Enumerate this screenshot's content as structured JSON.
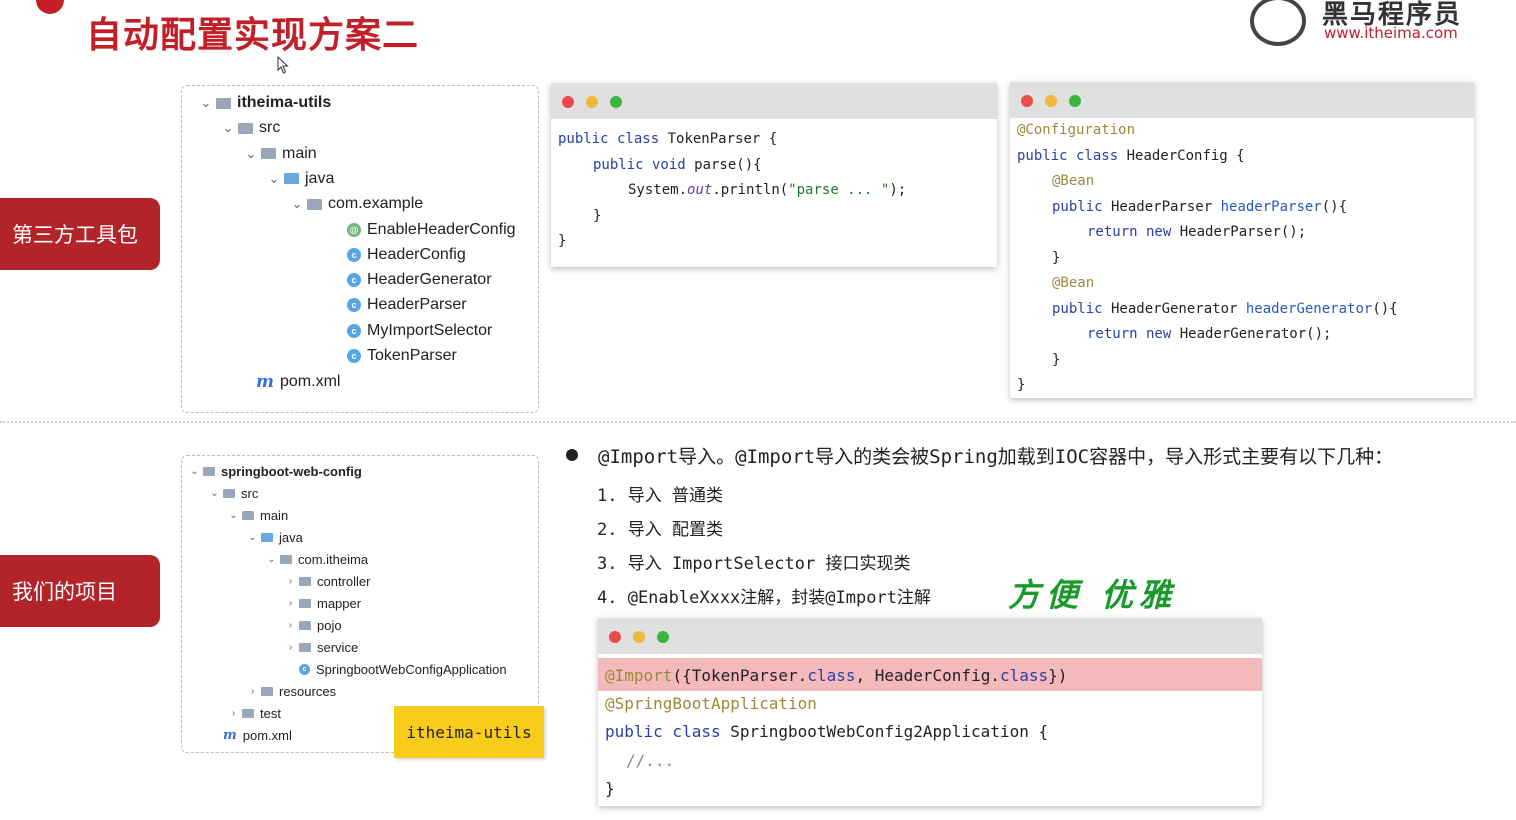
{
  "slide": {
    "title": "自动配置实现方案二",
    "logo_cn": "黑马程序员",
    "logo_url": "www.itheima.com",
    "section_labels": [
      "第三方工具包",
      "我们的项目"
    ]
  },
  "tree1": {
    "items": [
      {
        "label": "itheima-utils",
        "icon": "module-folder-icon",
        "chevron": "v"
      },
      {
        "label": "src",
        "icon": "folder-icon",
        "chevron": "v"
      },
      {
        "label": "main",
        "icon": "folder-icon",
        "chevron": "v"
      },
      {
        "label": "java",
        "icon": "source-folder-icon",
        "chevron": "v"
      },
      {
        "label": "com.example",
        "icon": "package-icon",
        "chevron": "v"
      },
      {
        "label": "EnableHeaderConfig",
        "icon": "annotation-icon",
        "chevron": ""
      },
      {
        "label": "HeaderConfig",
        "icon": "class-icon",
        "chevron": ""
      },
      {
        "label": "HeaderGenerator",
        "icon": "class-icon",
        "chevron": ""
      },
      {
        "label": "HeaderParser",
        "icon": "class-icon",
        "chevron": ""
      },
      {
        "label": "MyImportSelector",
        "icon": "class-icon",
        "chevron": ""
      },
      {
        "label": "TokenParser",
        "icon": "class-icon",
        "chevron": ""
      },
      {
        "label": "pom.xml",
        "icon": "maven-icon",
        "chevron": ""
      }
    ]
  },
  "tree2": {
    "items": [
      {
        "label": "springboot-web-config",
        "icon": "module-folder-icon",
        "chevron": "v"
      },
      {
        "label": "src",
        "icon": "folder-icon",
        "chevron": "v"
      },
      {
        "label": "main",
        "icon": "folder-icon",
        "chevron": "v"
      },
      {
        "label": "java",
        "icon": "source-folder-icon",
        "chevron": "v"
      },
      {
        "label": "com.itheima",
        "icon": "package-icon",
        "chevron": "v"
      },
      {
        "label": "controller",
        "icon": "package-icon",
        "chevron": ">"
      },
      {
        "label": "mapper",
        "icon": "package-icon",
        "chevron": ">"
      },
      {
        "label": "pojo",
        "icon": "package-icon",
        "chevron": ">"
      },
      {
        "label": "service",
        "icon": "package-icon",
        "chevron": ">"
      },
      {
        "label": "SpringbootWebConfigApplication",
        "icon": "spring-class-icon",
        "chevron": ""
      },
      {
        "label": "resources",
        "icon": "resources-folder-icon",
        "chevron": ">"
      },
      {
        "label": "test",
        "icon": "folder-icon",
        "chevron": ">"
      },
      {
        "label": "pom.xml",
        "icon": "maven-icon",
        "chevron": ""
      }
    ],
    "sticky_note": "itheima-utils"
  },
  "code_token_parser": {
    "l1_kw": "public class",
    "l1_rest": " TokenParser {",
    "l2_kw": "public void",
    "l2_rest": " parse(){",
    "l3_a": "System.",
    "l3_b": "out",
    "l3_c": ".println(",
    "l3_str": "\"parse ... \"",
    "l3_d": ");",
    "l4": "}",
    "l5": "}"
  },
  "code_header_config": {
    "l1": "@Configuration",
    "l2_kw": "public class",
    "l2_rest": " HeaderConfig {",
    "l3": "@Bean",
    "l4_kw": "public",
    "l4_type": " HeaderParser ",
    "l4_fn": "headerParser",
    "l4_rest": "(){",
    "l5_kw": "return new",
    "l5_rest": " HeaderParser();",
    "l6": "}",
    "l7": "@Bean",
    "l8_kw": "public",
    "l8_type": " HeaderGenerator ",
    "l8_fn": "headerGenerator",
    "l8_rest": "(){",
    "l9_kw": "return new",
    "l9_rest": " HeaderGenerator();",
    "l10": "}",
    "l11": "}"
  },
  "bullets": {
    "main": "@Import导入。@Import导入的类会被Spring加载到IOC容器中，导入形式主要有以下几种：",
    "items": [
      "1.  导入 普通类",
      "2.  导入 配置类",
      "3.  导入 ImportSelector 接口实现类",
      "4.  @EnableXxxx注解，封装@Import注解"
    ],
    "note": "方便 优雅"
  },
  "code_app": {
    "l1_ann": "@Import",
    "l1_a": "({TokenParser.",
    "l1_kw1": "class",
    "l1_b": ", HeaderConfig.",
    "l1_kw2": "class",
    "l1_c": "})",
    "l2": "@SpringBootApplication",
    "l3_kw": "public class",
    "l3_rest": " SpringbootWebConfig2Application {",
    "l4": "//...",
    "l5": "}"
  }
}
